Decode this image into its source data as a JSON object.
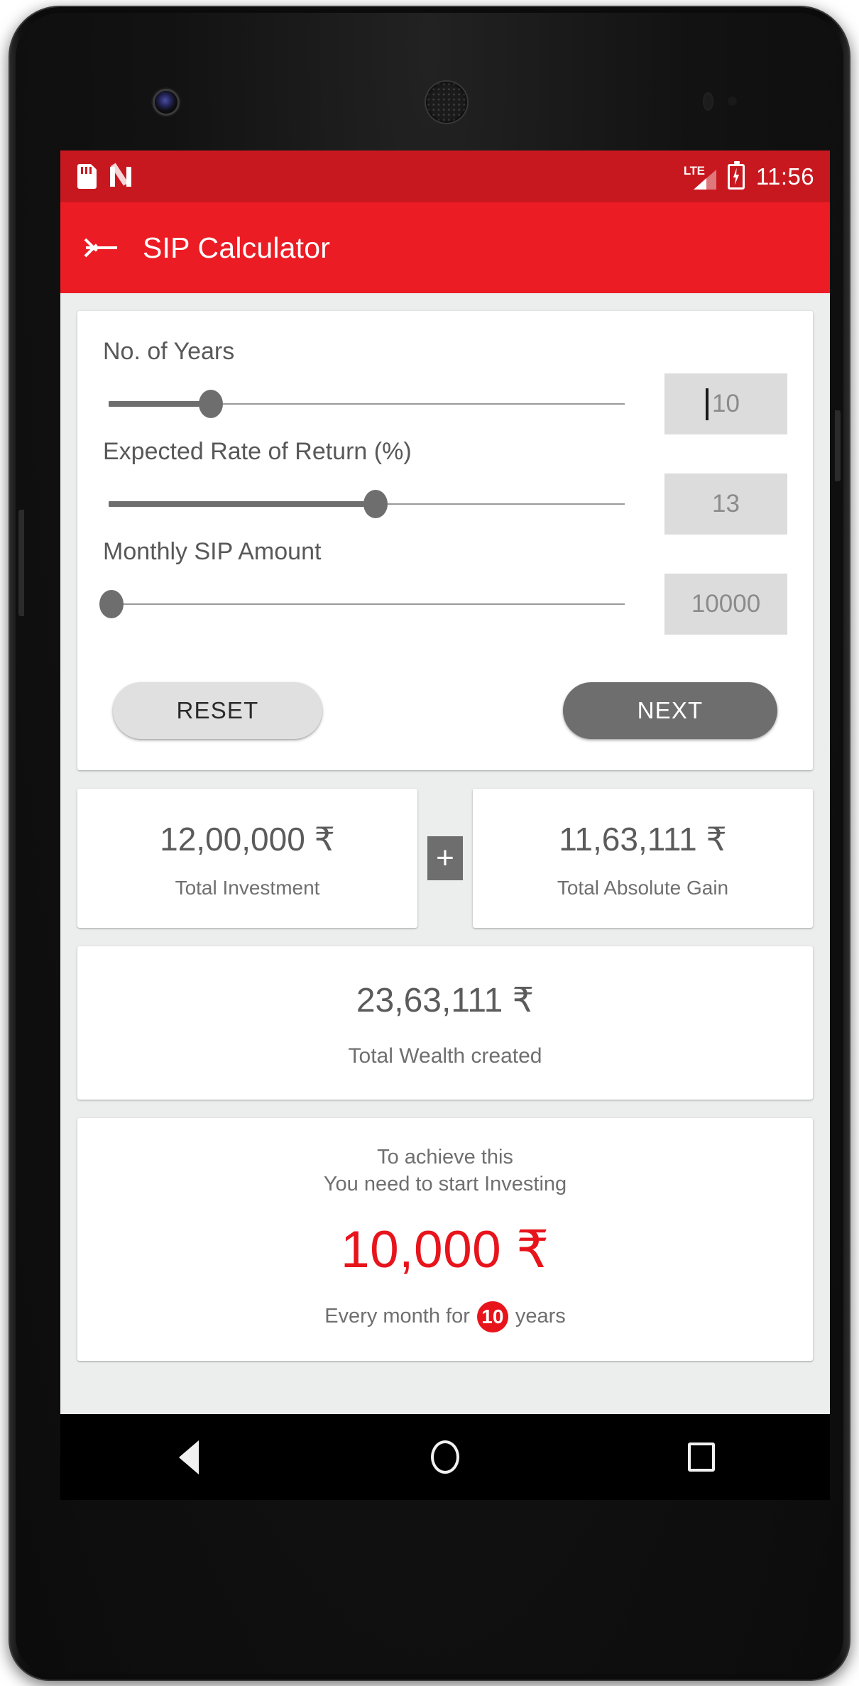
{
  "status_bar": {
    "sim_icon": "sim-card-icon",
    "nougat_icon": "android-nougat-icon",
    "network_label": "LTE",
    "signal_icon": "signal-bars-icon",
    "battery_icon": "battery-charging-icon",
    "time": "11:56"
  },
  "app_bar": {
    "back_icon": "back-arrow-icon",
    "title": "SIP Calculator"
  },
  "inputs": {
    "fields": [
      {
        "label": "No. of Years",
        "value": "10",
        "slider_percent": 19,
        "has_caret": true
      },
      {
        "label": "Expected Rate of Return (%)",
        "value": "13",
        "slider_percent": 53,
        "has_caret": false
      },
      {
        "label": "Monthly SIP Amount",
        "value": "10000",
        "slider_percent": 0,
        "has_caret": false
      }
    ],
    "reset_label": "RESET",
    "next_label": "NEXT"
  },
  "results": {
    "investment": {
      "value": "12,00,000 ₹",
      "label": "Total Investment"
    },
    "operator": "+",
    "gain": {
      "value": "11,63,111 ₹",
      "label": "Total Absolute Gain"
    },
    "wealth": {
      "value": "23,63,111 ₹",
      "label": "Total Wealth created"
    }
  },
  "achieve": {
    "line1": "To achieve this",
    "line2": "You need to start Investing",
    "amount": "10,000 ₹",
    "footer_prefix": "Every month for",
    "years_badge": "10",
    "footer_suffix": "years"
  },
  "nav_bar": {
    "back_icon": "nav-back-triangle-icon",
    "home_icon": "nav-home-circle-icon",
    "recents_icon": "nav-recents-square-icon"
  },
  "colors": {
    "status_bar": "#c8181f",
    "app_bar": "#ec1c24",
    "accent": "#e8141c",
    "page_bg": "#eceded",
    "card_bg": "#ffffff",
    "slider": "#6e6e6e",
    "value_box": "#dcdcdc"
  }
}
